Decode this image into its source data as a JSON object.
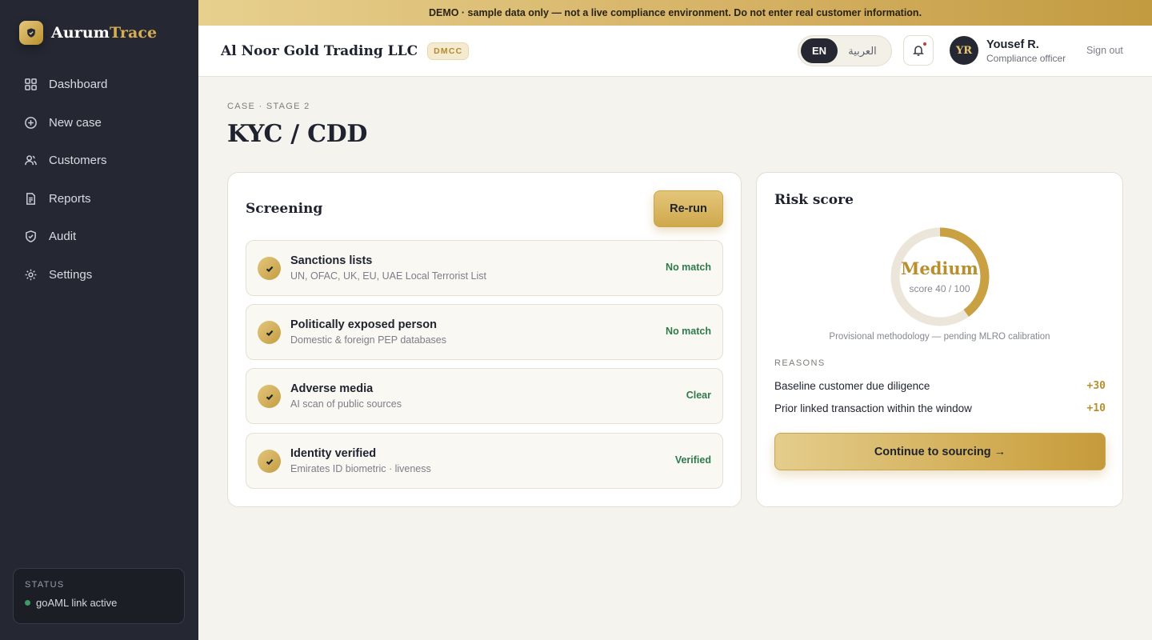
{
  "app": {
    "logo_part1": "Aurum",
    "logo_part2": "Trace",
    "accent_color": "#c9a550"
  },
  "banner": {
    "text": "DEMO · sample data only — not a live compliance environment. Do not enter real customer information."
  },
  "sidebar": {
    "items": [
      {
        "label": "Dashboard",
        "icon": "grid-icon"
      },
      {
        "label": "New case",
        "icon": "plus-circle-icon"
      },
      {
        "label": "Customers",
        "icon": "users-icon"
      },
      {
        "label": "Reports",
        "icon": "document-icon"
      },
      {
        "label": "Audit",
        "icon": "shield-check-icon"
      },
      {
        "label": "Settings",
        "icon": "gear-icon"
      }
    ],
    "status": {
      "label": "STATUS",
      "text": "goAML link active",
      "color": "#3f9b66"
    }
  },
  "header": {
    "org_name": "Al Noor Gold Trading LLC",
    "org_badge": "DMCC",
    "lang_en": "EN",
    "lang_ar": "العربية",
    "user_initials": "YR",
    "user_name": "Yousef R.",
    "user_role": "Compliance officer",
    "signout": "Sign out"
  },
  "main": {
    "breadcrumb": "CASE · STAGE 2",
    "title": "KYC / CDD"
  },
  "screening": {
    "title": "Screening",
    "rerun_label": "Re-run",
    "rows": [
      {
        "title": "Sanctions lists",
        "subtitle": "UN, OFAC, UK, EU, UAE Local Terrorist List",
        "status": "No match"
      },
      {
        "title": "Politically exposed person",
        "subtitle": "Domestic & foreign PEP databases",
        "status": "No match"
      },
      {
        "title": "Adverse media",
        "subtitle": "AI scan of public sources",
        "status": "Clear"
      },
      {
        "title": "Identity verified",
        "subtitle": "Emirates ID biometric · liveness",
        "status": "Verified"
      }
    ]
  },
  "risk": {
    "title": "Risk score",
    "level": "Medium",
    "score_text": "score 40 / 100",
    "score": 40,
    "score_max": 100,
    "methodology": "Provisional methodology — pending MLRO calibration",
    "reasons_label": "REASONS",
    "reasons": [
      {
        "label": "Baseline customer due diligence",
        "points": "+30"
      },
      {
        "label": "Prior linked transaction within the window",
        "points": "+10"
      }
    ],
    "continue_label": "Continue to sourcing →"
  }
}
